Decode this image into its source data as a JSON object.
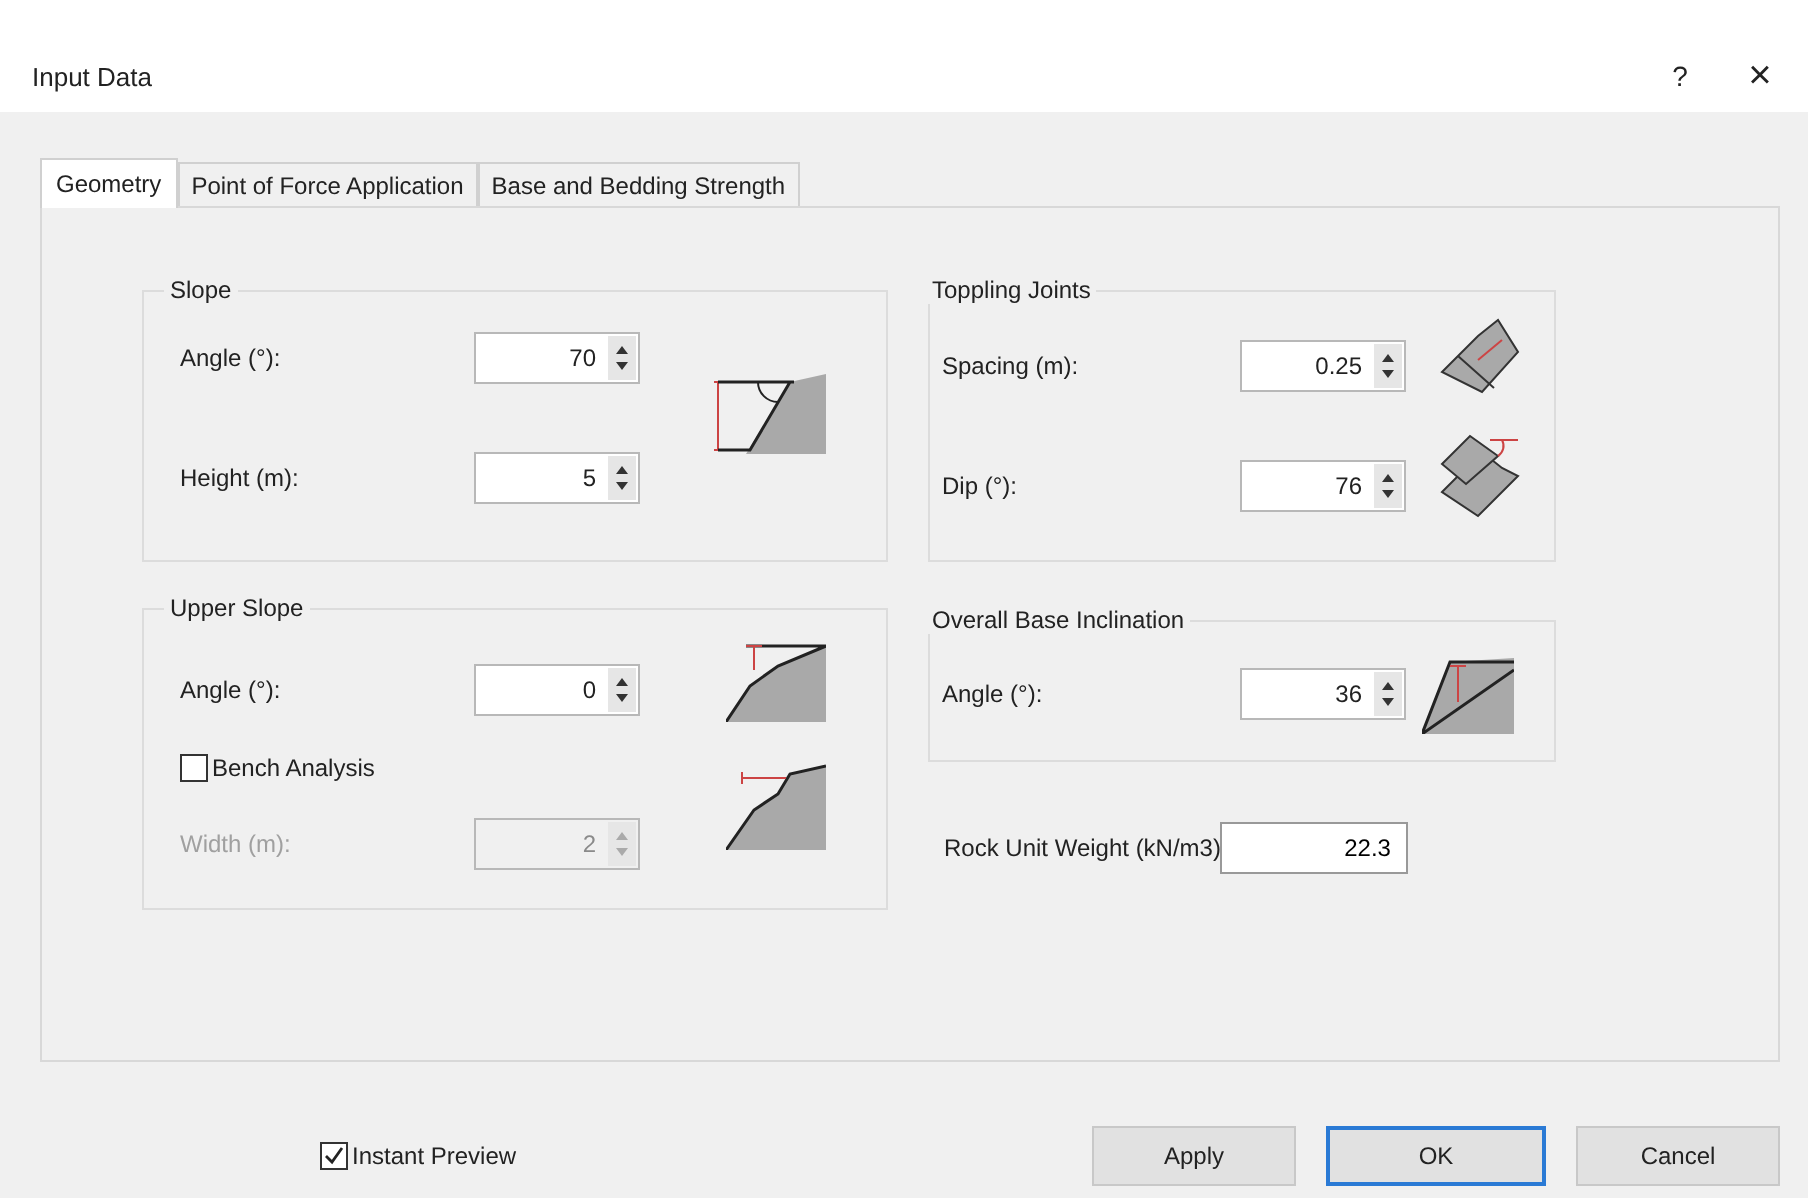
{
  "window": {
    "title": "Input Data",
    "help": "?",
    "close": "×"
  },
  "tabs": [
    {
      "label": "Geometry",
      "selected": true
    },
    {
      "label": "Point of Force Application",
      "selected": false
    },
    {
      "label": "Base and Bedding Strength",
      "selected": false
    }
  ],
  "slope": {
    "title": "Slope",
    "fields": [
      {
        "label": "Angle (°):",
        "value": "70",
        "disabled": false
      },
      {
        "label": "Height (m):",
        "value": "5",
        "disabled": false
      }
    ]
  },
  "upper_slope": {
    "title": "Upper Slope",
    "fields": [
      {
        "label": "Angle (°):",
        "value": "0",
        "disabled": false
      }
    ],
    "bench": {
      "label": "Bench Analysis",
      "checked": false
    },
    "bench_width": {
      "label": "Width (m):",
      "value": "2",
      "disabled": true
    }
  },
  "toppling_joints": {
    "title": "Toppling Joints",
    "fields": [
      {
        "label": "Spacing (m):",
        "value": "0.25",
        "disabled": false
      },
      {
        "label": "Dip (°):",
        "value": "76",
        "disabled": false
      }
    ]
  },
  "overall_base_inclination": {
    "title": "Overall Base Inclination",
    "fields": [
      {
        "label": "Angle (°):",
        "value": "36",
        "disabled": false
      }
    ]
  },
  "rock_unit_weight": {
    "label": "Rock Unit Weight (kN/m3)",
    "value": "22.3"
  },
  "instant_preview": {
    "label": "Instant Preview",
    "checked": true
  },
  "buttons": [
    {
      "label": "Apply",
      "default": false
    },
    {
      "label": "OK",
      "default": true
    },
    {
      "label": "Cancel",
      "default": false
    }
  ]
}
